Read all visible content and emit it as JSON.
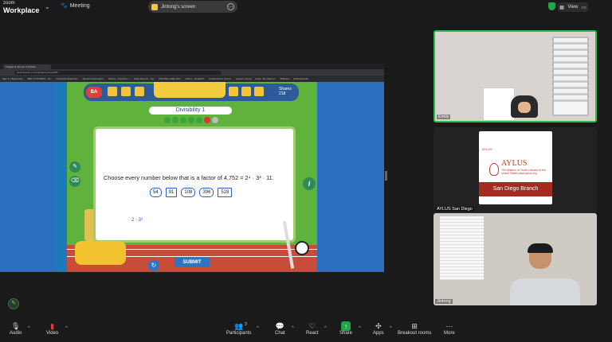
{
  "app": {
    "brand_small": "zoom",
    "brand_big": "Workplace",
    "meeting_label": "Meeting"
  },
  "share": {
    "title": "Jintong's screen"
  },
  "view": {
    "label": "View"
  },
  "browser": {
    "tab_title": "Chapter 3: All Lexi 3.3 Divisi...",
    "url": "beastacademy.com/academy/book/5/8/...",
    "bookmarks": [
      "Sign in | Beast Aca...",
      "BBC TUTORING - Go...",
      "Columbia Student E...",
      "Student information...",
      "Niantic - Freedom t...",
      "Daily Reports - Ng...",
      "p/lab Blue Math Wor...",
      "Aphex - arcadeM...",
      "problemshow | Done...",
      "Lesson | Home",
      "Anpur: Be sharp of...",
      "IRMaster",
      "All Bookmarks"
    ]
  },
  "game": {
    "logo": "BA",
    "banner_title": "Divisibility 1",
    "shares_label": "Shares",
    "shares_count": "218",
    "question": "Choose every number below that is a factor of 4,752 = 2⁴ · 3³ · 11.",
    "choices": [
      "54",
      "91",
      "108",
      "396",
      "528"
    ],
    "annotation": "2 · 3³",
    "submit": "SUBMIT",
    "reset_icon": "↻",
    "info_icon": "i"
  },
  "participants": [
    {
      "name": "Emily"
    },
    {
      "name": "AYLUS San Diego"
    },
    {
      "name": "Jintong"
    }
  ],
  "aylus_card": {
    "small": "AYLUS",
    "big": "AYLUS",
    "tagline": "The Alliance of Youth Leaders in the United States www.aylus.org",
    "branch": "San Diego Branch"
  },
  "toolbar": {
    "audio": "Audio",
    "video": "Video",
    "participants": "Participants",
    "participant_count": "3",
    "chat": "Chat",
    "react": "React",
    "share": "Share",
    "apps": "Apps",
    "breakout": "Breakout rooms",
    "more": "More"
  }
}
